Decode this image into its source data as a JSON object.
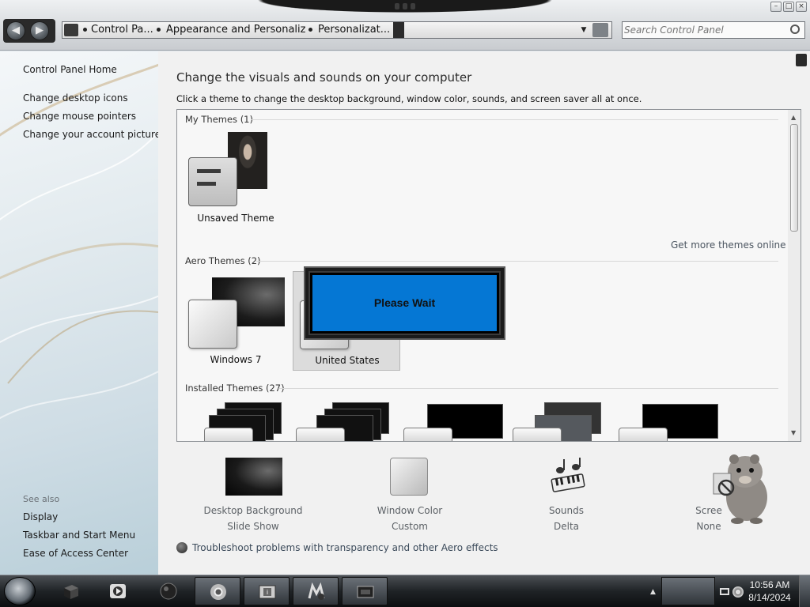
{
  "window": {
    "minimize_glyph": "–",
    "maximize_glyph": "□",
    "close_glyph": "×"
  },
  "navigation": {
    "back_glyph": "◀",
    "forward_glyph": "▶",
    "breadcrumbs": [
      "Control Pa...",
      "Appearance and Personaliz...",
      "Personalizat..."
    ],
    "dropdown_glyph": "▼"
  },
  "search": {
    "placeholder": "Search Control Panel"
  },
  "sidebar": {
    "home": "Control Panel Home",
    "tasks": [
      "Change desktop icons",
      "Change mouse pointers",
      "Change your account picture"
    ],
    "see_also_title": "See also",
    "see_also": [
      "Display",
      "Taskbar and Start Menu",
      "Ease of Access Center"
    ]
  },
  "main": {
    "heading": "Change the visuals and sounds on your computer",
    "instructions": "Click a theme to change the desktop background, window color, sounds, and screen saver all at once.",
    "get_more_themes": "Get more themes online",
    "groups": {
      "my_themes": "My Themes (1)",
      "aero_themes": "Aero Themes (2)",
      "installed_themes": "Installed Themes (27)"
    },
    "themes": {
      "unsaved": "Unsaved Theme",
      "windows7": "Windows 7",
      "united_states": "United States"
    },
    "scroll_up_glyph": "▲",
    "scroll_down_glyph": "▼"
  },
  "settings": {
    "desktop_background": {
      "label": "Desktop Background",
      "value": "Slide Show"
    },
    "window_color": {
      "label": "Window Color",
      "value": "Custom"
    },
    "sounds": {
      "label": "Sounds",
      "value": "Delta"
    },
    "screen_saver": {
      "label": "Scree",
      "value": "None"
    }
  },
  "troubleshoot_link": "Troubleshoot problems with transparency and other Aero effects",
  "dialog": {
    "message": "Please Wait"
  },
  "taskbar": {
    "time": "10:56 AM",
    "date": "8/14/2024",
    "tray_chevron_glyph": "▲"
  },
  "colors": {
    "dialog_blue": "#0577d4",
    "content_bg": "#f1f1f1",
    "taskbar": "#1f2326"
  }
}
